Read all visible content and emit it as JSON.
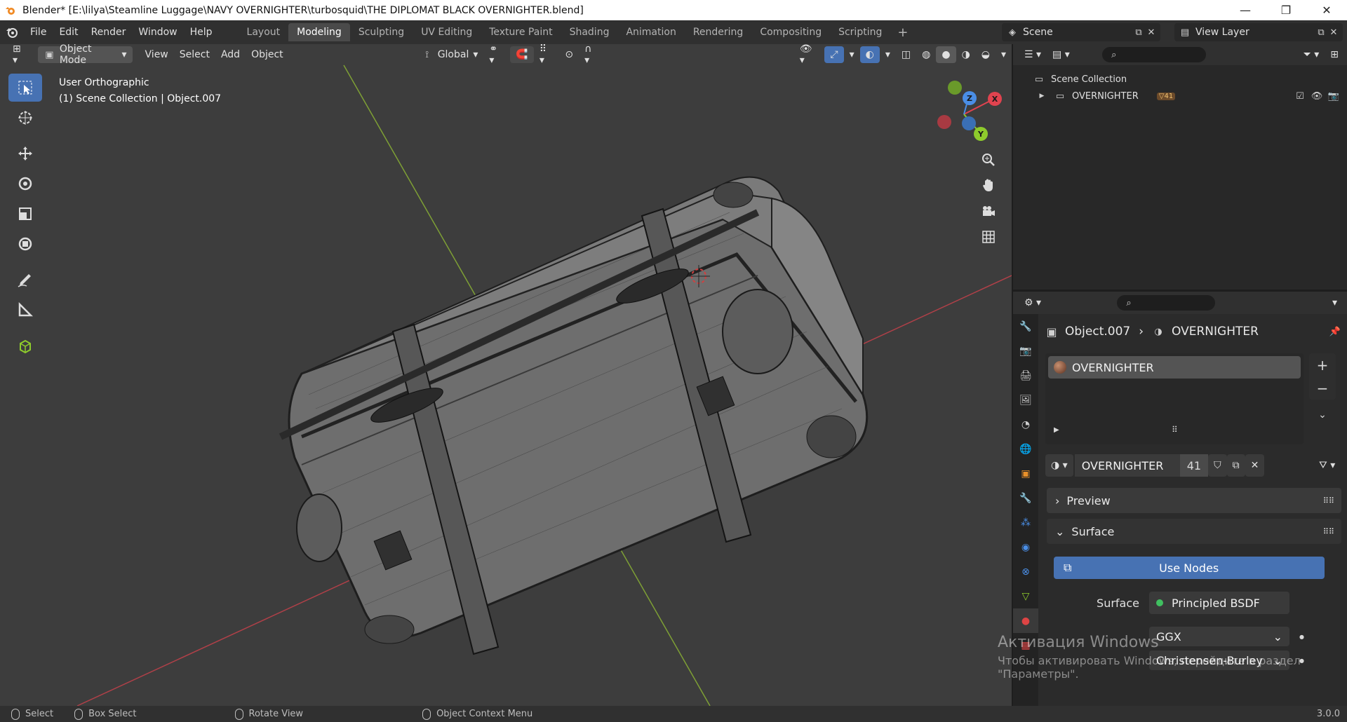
{
  "window": {
    "title": "Blender* [E:\\lilya\\Steamline Luggage\\NAVY OVERNIGHTER\\turbosquid\\THE DIPLOMAT BLACK OVERNIGHTER.blend]",
    "minimize": "—",
    "maximize": "❐",
    "close": "✕"
  },
  "menu": [
    "File",
    "Edit",
    "Render",
    "Window",
    "Help"
  ],
  "workspaces": [
    {
      "label": "Layout",
      "active": false
    },
    {
      "label": "Modeling",
      "active": true
    },
    {
      "label": "Sculpting",
      "active": false
    },
    {
      "label": "UV Editing",
      "active": false
    },
    {
      "label": "Texture Paint",
      "active": false
    },
    {
      "label": "Shading",
      "active": false
    },
    {
      "label": "Animation",
      "active": false
    },
    {
      "label": "Rendering",
      "active": false
    },
    {
      "label": "Compositing",
      "active": false
    },
    {
      "label": "Scripting",
      "active": false
    }
  ],
  "scene_name": "Scene",
  "view_layer": "View Layer",
  "viewport": {
    "mode": "Object Mode",
    "menus": [
      "View",
      "Select",
      "Add",
      "Object"
    ],
    "transform_orientation": "Global",
    "view_name": "User Orthographic",
    "context": "(1) Scene Collection | Object.007",
    "gizmo_axes": {
      "x": "X",
      "y": "Y",
      "z": "Z"
    }
  },
  "outliner": {
    "root": "Scene Collection",
    "items": [
      {
        "label": "OVERNIGHTER",
        "badge": "41"
      }
    ]
  },
  "properties": {
    "object": "Object.007",
    "material": "OVERNIGHTER",
    "slot_material": "OVERNIGHTER",
    "datablock_name": "OVERNIGHTER",
    "user_count": "41",
    "preview_label": "Preview",
    "surface_label": "Surface",
    "use_nodes": "Use Nodes",
    "surface_field_label": "Surface",
    "surface_value": "Principled BSDF",
    "distribution": "GGX",
    "subsurface_method": "Christensen-Burley"
  },
  "status": {
    "select": "Select",
    "box_select": "Box Select",
    "rotate_view": "Rotate View",
    "context_menu": "Object Context Menu",
    "version": "3.0.0"
  },
  "watermark": {
    "line1": "Активация Windows",
    "line2": "Чтобы активировать Windows, перейдите в раздел",
    "line3": "\"Параметры\"."
  },
  "colors": {
    "accent": "#4772b3",
    "axis_x": "#e0434f",
    "axis_y": "#8ecb2c",
    "axis_z": "#4a8ee6"
  }
}
